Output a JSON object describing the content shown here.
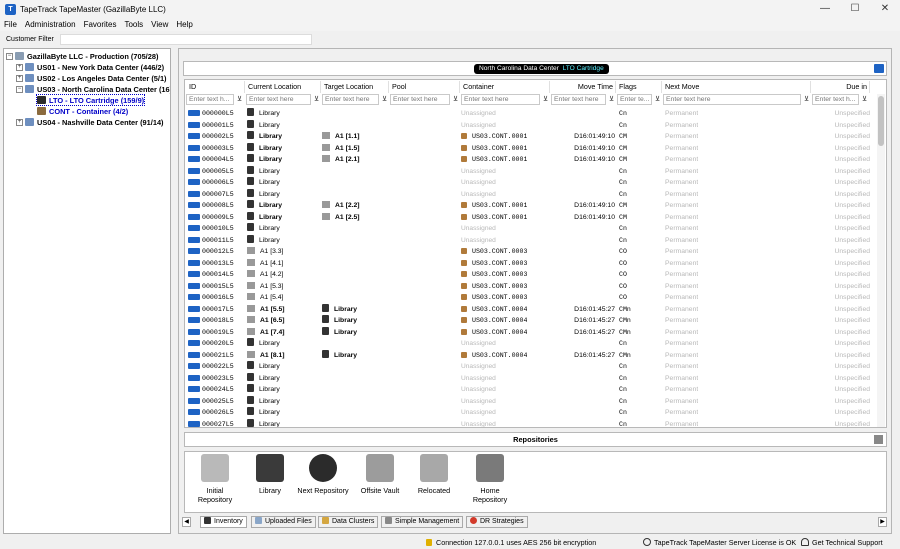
{
  "window": {
    "title": "TapeTrack TapeMaster (GazillaByte LLC)",
    "app_icon": "tapetrack-app-icon",
    "minimize": "—",
    "maximize": "☐",
    "close": "✕"
  },
  "menu": [
    "File",
    "Administration",
    "Favorites",
    "Tools",
    "View",
    "Help"
  ],
  "filter": {
    "label": "Customer Filter",
    "value": ""
  },
  "tree": {
    "root": "GazillaByte LLC - Production (705/28)",
    "nodes": [
      {
        "label": "US01 - New York Data Center (446/2)",
        "expand": "+"
      },
      {
        "label": "US02 - Los Angeles Data Center (5/1)",
        "expand": "+"
      },
      {
        "label": "US03 - North Carolina Data Center (16)",
        "expand": "−"
      },
      {
        "label": "LTO - LTO Cartridge (159/9)"
      },
      {
        "label": "CONT - Container (4/2)"
      },
      {
        "label": "US04 - Nashville Data Center (91/14)",
        "expand": "+"
      }
    ],
    "root_expand": "−"
  },
  "context": {
    "pill_dc": "North Carolina Data Center",
    "pill_media": "LTO Cartridge"
  },
  "columns": [
    "ID",
    "Current Location",
    "Target Location",
    "Pool",
    "Container",
    "Move Time",
    "Flags",
    "Next Move",
    "Due in"
  ],
  "filter_placeholders": [
    "Enter text h...",
    "Enter text here",
    "Enter text here",
    "Enter text here",
    "Enter text here",
    "Enter text here",
    "Enter te...",
    "Enter text here",
    "Enter text h..."
  ],
  "filter_icon": "⊻",
  "rows": [
    {
      "id": "000000L5",
      "cur": "Library",
      "cur_b": false,
      "tgt": "",
      "pool": "",
      "cont": "Unassigned",
      "time": "",
      "flags": "Cn",
      "next": "Permanent",
      "due": "Unspecified"
    },
    {
      "id": "000001L5",
      "cur": "Library",
      "cur_b": false,
      "tgt": "",
      "pool": "",
      "cont": "Unassigned",
      "time": "",
      "flags": "Cn",
      "next": "Permanent",
      "due": "Unspecified"
    },
    {
      "id": "000002L5",
      "cur": "Library",
      "cur_b": true,
      "tgt": "A1 [1.1]",
      "pool": "",
      "cont": "US03.CONT.0001",
      "time": "D16:01:49:10",
      "flags": "CM",
      "next": "Permanent",
      "due": "Unspecified"
    },
    {
      "id": "000003L5",
      "cur": "Library",
      "cur_b": true,
      "tgt": "A1 [1.5]",
      "pool": "",
      "cont": "US03.CONT.0001",
      "time": "D16:01:49:10",
      "flags": "CM",
      "next": "Permanent",
      "due": "Unspecified"
    },
    {
      "id": "000004L5",
      "cur": "Library",
      "cur_b": true,
      "tgt": "A1 [2.1]",
      "pool": "",
      "cont": "US03.CONT.0001",
      "time": "D16:01:49:10",
      "flags": "CM",
      "next": "Permanent",
      "due": "Unspecified"
    },
    {
      "id": "000005L5",
      "cur": "Library",
      "cur_b": false,
      "tgt": "",
      "pool": "",
      "cont": "Unassigned",
      "time": "",
      "flags": "Cn",
      "next": "Permanent",
      "due": "Unspecified"
    },
    {
      "id": "000006L5",
      "cur": "Library",
      "cur_b": false,
      "tgt": "",
      "pool": "",
      "cont": "Unassigned",
      "time": "",
      "flags": "Cn",
      "next": "Permanent",
      "due": "Unspecified"
    },
    {
      "id": "000007L5",
      "cur": "Library",
      "cur_b": false,
      "tgt": "",
      "pool": "",
      "cont": "Unassigned",
      "time": "",
      "flags": "Cn",
      "next": "Permanent",
      "due": "Unspecified"
    },
    {
      "id": "000008L5",
      "cur": "Library",
      "cur_b": true,
      "tgt": "A1 [2.2]",
      "pool": "",
      "cont": "US03.CONT.0001",
      "time": "D16:01:49:10",
      "flags": "CM",
      "next": "Permanent",
      "due": "Unspecified"
    },
    {
      "id": "000009L5",
      "cur": "Library",
      "cur_b": true,
      "tgt": "A1 [2.5]",
      "pool": "",
      "cont": "US03.CONT.0001",
      "time": "D16:01:49:10",
      "flags": "CM",
      "next": "Permanent",
      "due": "Unspecified"
    },
    {
      "id": "000010L5",
      "cur": "Library",
      "cur_b": false,
      "tgt": "",
      "pool": "",
      "cont": "Unassigned",
      "time": "",
      "flags": "Cn",
      "next": "Permanent",
      "due": "Unspecified"
    },
    {
      "id": "000011L5",
      "cur": "Library",
      "cur_b": false,
      "tgt": "",
      "pool": "",
      "cont": "Unassigned",
      "time": "",
      "flags": "Cn",
      "next": "Permanent",
      "due": "Unspecified"
    },
    {
      "id": "000012L5",
      "cur": "A1 [3.3]",
      "cur_b": false,
      "tgt": "",
      "pool": "",
      "cont": "US03.CONT.0003",
      "time": "",
      "flags": "CO",
      "next": "Permanent",
      "due": "Unspecified"
    },
    {
      "id": "000013L5",
      "cur": "A1 [4.1]",
      "cur_b": false,
      "tgt": "",
      "pool": "",
      "cont": "US03.CONT.0003",
      "time": "",
      "flags": "CO",
      "next": "Permanent",
      "due": "Unspecified"
    },
    {
      "id": "000014L5",
      "cur": "A1 [4.2]",
      "cur_b": false,
      "tgt": "",
      "pool": "",
      "cont": "US03.CONT.0003",
      "time": "",
      "flags": "CO",
      "next": "Permanent",
      "due": "Unspecified"
    },
    {
      "id": "000015L5",
      "cur": "A1 [5.3]",
      "cur_b": false,
      "tgt": "",
      "pool": "",
      "cont": "US03.CONT.0003",
      "time": "",
      "flags": "CO",
      "next": "Permanent",
      "due": "Unspecified"
    },
    {
      "id": "000016L5",
      "cur": "A1 [5.4]",
      "cur_b": false,
      "tgt": "",
      "pool": "",
      "cont": "US03.CONT.0003",
      "time": "",
      "flags": "CO",
      "next": "Permanent",
      "due": "Unspecified"
    },
    {
      "id": "000017L5",
      "cur": "A1 [5.5]",
      "cur_b": true,
      "tgt": "Library",
      "pool": "",
      "cont": "US03.CONT.0004",
      "time": "D16:01:45:27",
      "flags": "CMn",
      "next": "Permanent",
      "due": "Unspecified"
    },
    {
      "id": "000018L5",
      "cur": "A1 [6.5]",
      "cur_b": true,
      "tgt": "Library",
      "pool": "",
      "cont": "US03.CONT.0004",
      "time": "D16:01:45:27",
      "flags": "CMn",
      "next": "Permanent",
      "due": "Unspecified"
    },
    {
      "id": "000019L5",
      "cur": "A1 [7.4]",
      "cur_b": true,
      "tgt": "Library",
      "pool": "",
      "cont": "US03.CONT.0004",
      "time": "D16:01:45:27",
      "flags": "CMn",
      "next": "Permanent",
      "due": "Unspecified"
    },
    {
      "id": "000020L5",
      "cur": "Library",
      "cur_b": false,
      "tgt": "",
      "pool": "",
      "cont": "Unassigned",
      "time": "",
      "flags": "Cn",
      "next": "Permanent",
      "due": "Unspecified"
    },
    {
      "id": "000021L5",
      "cur": "A1 [8.1]",
      "cur_b": true,
      "tgt": "Library",
      "pool": "",
      "cont": "US03.CONT.0004",
      "time": "D16:01:45:27",
      "flags": "CMn",
      "next": "Permanent",
      "due": "Unspecified"
    },
    {
      "id": "000022L5",
      "cur": "Library",
      "cur_b": false,
      "tgt": "",
      "pool": "",
      "cont": "Unassigned",
      "time": "",
      "flags": "Cn",
      "next": "Permanent",
      "due": "Unspecified"
    },
    {
      "id": "000023L5",
      "cur": "Library",
      "cur_b": false,
      "tgt": "",
      "pool": "",
      "cont": "Unassigned",
      "time": "",
      "flags": "Cn",
      "next": "Permanent",
      "due": "Unspecified"
    },
    {
      "id": "000024L5",
      "cur": "Library",
      "cur_b": false,
      "tgt": "",
      "pool": "",
      "cont": "Unassigned",
      "time": "",
      "flags": "Cn",
      "next": "Permanent",
      "due": "Unspecified"
    },
    {
      "id": "000025L5",
      "cur": "Library",
      "cur_b": false,
      "tgt": "",
      "pool": "",
      "cont": "Unassigned",
      "time": "",
      "flags": "Cn",
      "next": "Permanent",
      "due": "Unspecified"
    },
    {
      "id": "000026L5",
      "cur": "Library",
      "cur_b": false,
      "tgt": "",
      "pool": "",
      "cont": "Unassigned",
      "time": "",
      "flags": "Cn",
      "next": "Permanent",
      "due": "Unspecified"
    },
    {
      "id": "000027L5",
      "cur": "Library",
      "cur_b": false,
      "tgt": "",
      "pool": "",
      "cont": "Unassigned",
      "time": "",
      "flags": "Cn",
      "next": "Permanent",
      "due": "Unspecified"
    }
  ],
  "repositories": {
    "title": "Repositories",
    "items": [
      {
        "label": "Initial\nRepository",
        "icon": "initial-repository-icon",
        "color": "#b9b9b9"
      },
      {
        "label": "Library",
        "icon": "library-icon",
        "color": "#3a3a3a"
      },
      {
        "label": "Next Repository",
        "icon": "next-repository-icon",
        "color": "#2b2b2b"
      },
      {
        "label": "Offsite Vault",
        "icon": "offsite-vault-icon",
        "color": "#9c9c9c"
      },
      {
        "label": "Relocated",
        "icon": "relocated-icon",
        "color": "#a8a8a8"
      },
      {
        "label": "Home\nRepository",
        "icon": "home-repository-icon",
        "color": "#7a7a7a"
      }
    ]
  },
  "tabs": [
    {
      "label": "Inventory",
      "color": "#333333"
    },
    {
      "label": "Uploaded Files",
      "color": "#8aa6c8"
    },
    {
      "label": "Data Clusters",
      "color": "#d4a640"
    },
    {
      "label": "Simple Management",
      "color": "#888888"
    },
    {
      "label": "DR Strategies",
      "color": "#d23a2a"
    }
  ],
  "tab_nav": {
    "prev": "◀",
    "next": "▶"
  },
  "status": {
    "connection": "Connection 127.0.0.1 uses AES 256 bit encryption",
    "license": "TapeTrack TapeMaster Server License is OK",
    "support": "Get Technical Support"
  },
  "colors": {
    "accent": "#1e63c4",
    "pill_highlight": "#5cf0ff",
    "muted": "#b8b8b8"
  }
}
